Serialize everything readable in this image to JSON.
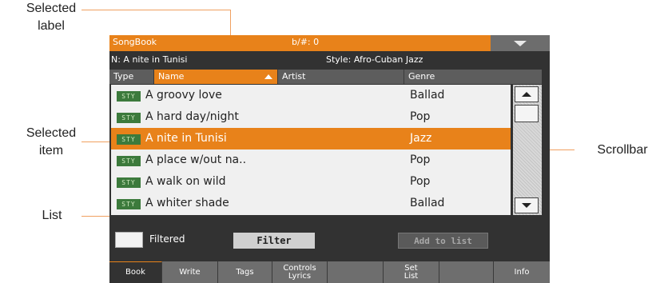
{
  "callouts": {
    "selected_label": [
      "Selected",
      "label"
    ],
    "selected_item": [
      "Selected",
      "item"
    ],
    "list": "List",
    "scrollbar": "Scrollbar"
  },
  "titlebar": {
    "title": "SongBook",
    "field": "b/#: 0"
  },
  "info": {
    "song": "N: A nite in Tunisi",
    "style": "Style: Afro-Cuban Jazz"
  },
  "columns": {
    "type": "Type",
    "name": "Name",
    "artist": "Artist",
    "genre": "Genre"
  },
  "rows": [
    {
      "badge": "STY",
      "name": "A groovy love",
      "genre": "Ballad"
    },
    {
      "badge": "STY",
      "name": "A hard day/night",
      "genre": "Pop"
    },
    {
      "badge": "STY",
      "name": "A nite in Tunisi",
      "genre": "Jazz"
    },
    {
      "badge": "STY",
      "name": "A place w/out na..",
      "genre": "Pop"
    },
    {
      "badge": "STY",
      "name": "A walk on wild",
      "genre": "Pop"
    },
    {
      "badge": "STY",
      "name": "A whiter shade",
      "genre": "Ballad"
    }
  ],
  "controls": {
    "filtered": "Filtered",
    "filter": "Filter",
    "add_to_list": "Add to list"
  },
  "tabs": {
    "book": "Book",
    "write": "Write",
    "tags": "Tags",
    "controls_1": "Controls",
    "controls_2": "Lyrics",
    "setlist_1": "Set",
    "setlist_2": "List",
    "info": "Info"
  },
  "colors": {
    "accent": "#e8821a",
    "panel": "#323232",
    "list_bg": "#f0f0f0",
    "badge": "#3c7a3c"
  }
}
